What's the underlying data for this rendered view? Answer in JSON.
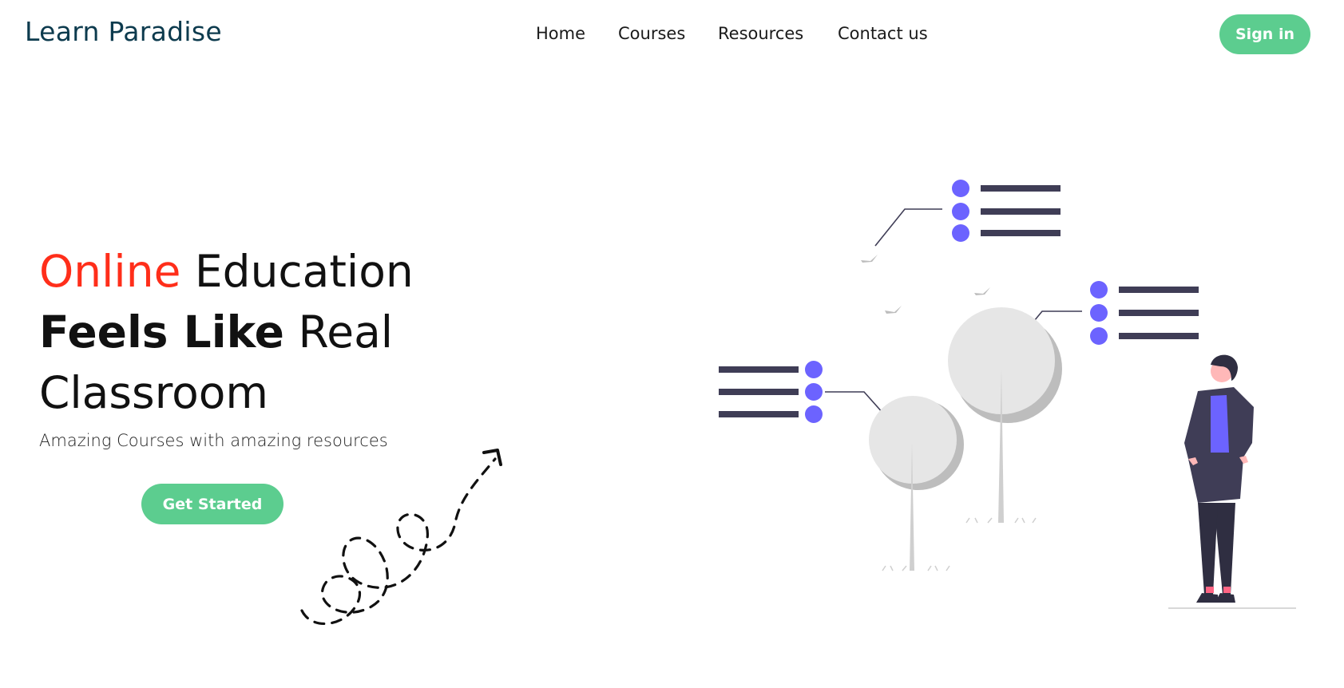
{
  "header": {
    "logo": "Learn Paradise",
    "nav": [
      {
        "label": "Home"
      },
      {
        "label": "Courses"
      },
      {
        "label": "Resources"
      },
      {
        "label": "Contact us"
      }
    ],
    "signin_label": "Sign in"
  },
  "hero": {
    "title_accent": "Online",
    "title_rest1": " Education",
    "title_bold": "Feels Like",
    "title_rest2": " Real",
    "title_line3": "Classroom",
    "subtitle": "Amazing Courses with amazing resources",
    "cta_label": "Get Started"
  },
  "colors": {
    "accent": "#ff2e1a",
    "button": "#5ccd8f",
    "logo": "#0d3b4e",
    "illustration_primary": "#6c63ff",
    "illustration_dark": "#3f3d56"
  },
  "icons": [
    "dashed-arrow-squiggle",
    "person-with-trees-illustration"
  ]
}
